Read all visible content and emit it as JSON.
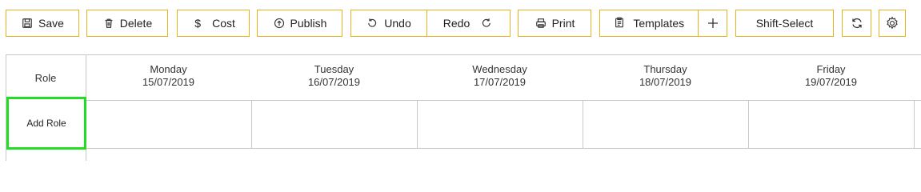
{
  "toolbar": {
    "save": "Save",
    "delete": "Delete",
    "cost": "Cost",
    "publish": "Publish",
    "undo": "Undo",
    "redo": "Redo",
    "print": "Print",
    "templates": "Templates",
    "shift_select": "Shift-Select",
    "accent_color": "#e8b21f"
  },
  "grid": {
    "role_header": "Role",
    "add_role": "Add Role",
    "days": [
      {
        "day": "Monday",
        "date": "15/07/2019"
      },
      {
        "day": "Tuesday",
        "date": "16/07/2019"
      },
      {
        "day": "Wednesday",
        "date": "17/07/2019"
      },
      {
        "day": "Thursday",
        "date": "18/07/2019"
      },
      {
        "day": "Friday",
        "date": "19/07/2019"
      }
    ],
    "highlight_color": "#22dd22"
  }
}
